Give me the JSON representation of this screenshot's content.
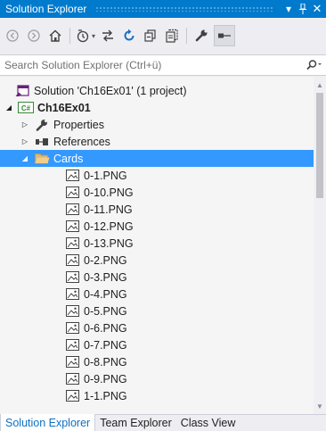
{
  "window": {
    "title": "Solution Explorer",
    "accent_color": "#007acc",
    "selection_color": "#3399ff"
  },
  "titlebar": {
    "dropdown_icon": "chevron-down-icon",
    "pin_icon": "pin-icon",
    "close_icon": "close-icon"
  },
  "toolbar": {
    "icons": [
      "back-icon",
      "forward-icon",
      "home-icon",
      "history-icon",
      "sync-icon",
      "refresh-icon",
      "collapse-all-icon",
      "show-all-files-icon",
      "properties-icon",
      "preview-icon"
    ]
  },
  "search": {
    "placeholder": "Search Solution Explorer (Ctrl+ü)",
    "value": ""
  },
  "tree": {
    "solution_label": "Solution 'Ch16Ex01' (1 project)",
    "project_label": "Ch16Ex01",
    "project_badge": "C#",
    "properties_label": "Properties",
    "references_label": "References",
    "folder_label": "Cards",
    "files": [
      "0-1.PNG",
      "0-10.PNG",
      "0-11.PNG",
      "0-12.PNG",
      "0-13.PNG",
      "0-2.PNG",
      "0-3.PNG",
      "0-4.PNG",
      "0-5.PNG",
      "0-6.PNG",
      "0-7.PNG",
      "0-8.PNG",
      "0-9.PNG",
      "1-1.PNG"
    ]
  },
  "tabs": [
    {
      "label": "Solution Explorer",
      "active": true
    },
    {
      "label": "Team Explorer",
      "active": false
    },
    {
      "label": "Class View",
      "active": false
    }
  ]
}
